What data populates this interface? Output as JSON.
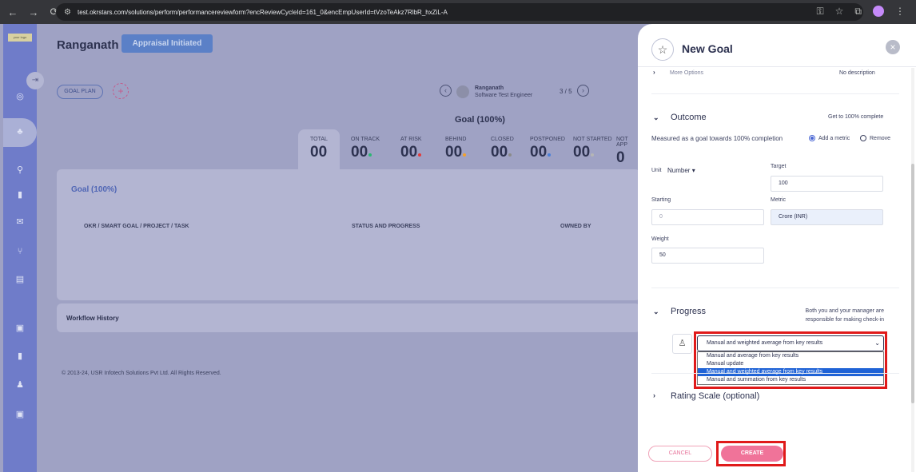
{
  "browser": {
    "url": "test.okrstars.com/solutions/perform/performancereviewform?encReviewCycleId=161_0&encEmpUserId=tVzoTeAkz7RlbR_hxZiL-A"
  },
  "sidebar": {
    "logo_text": "your logo"
  },
  "header": {
    "employee_name": "Ranganath",
    "status": "Appraisal Initiated"
  },
  "goal_plan": {
    "button_label": "GOAL PLAN",
    "nav": {
      "name": "Ranganath",
      "role": "Software Test Engineer",
      "counter": "3 / 5"
    },
    "goal_percent": "Goal (100%)"
  },
  "stats": [
    {
      "label": "TOTAL",
      "value": "00",
      "dot": ""
    },
    {
      "label": "ON TRACK",
      "value": "00",
      "dot": "#2bb673"
    },
    {
      "label": "AT RISK",
      "value": "00",
      "dot": "#e23a3a"
    },
    {
      "label": "BEHIND",
      "value": "00",
      "dot": "#f2a12c"
    },
    {
      "label": "CLOSED",
      "value": "00",
      "dot": "#8a8a8a"
    },
    {
      "label": "POSTPONED",
      "value": "00",
      "dot": "#4a80d8"
    },
    {
      "label": "NOT STARTED",
      "value": "00",
      "dot": "#b5b5b5"
    },
    {
      "label": "NOT APP",
      "value": "0",
      "dot": ""
    }
  ],
  "goal_card": {
    "tab_label": "Goal (100%)",
    "columns": [
      "OKR / SMART GOAL / PROJECT / TASK",
      "STATUS AND PROGRESS",
      "OWNED BY"
    ]
  },
  "workflow": {
    "label": "Workflow History"
  },
  "footer": {
    "text": "© 2013-24, USR Infotech Solutions Pvt Ltd. All Rights Reserved."
  },
  "drawer": {
    "title": "New Goal",
    "more_options": "More Options",
    "no_description": "No description",
    "outcome": {
      "title": "Outcome",
      "hint": "Get to 100% complete",
      "measured_text": "Measured as a goal towards 100% completion",
      "radio_add": "Add a metric",
      "radio_remove": "Remove",
      "unit_label": "Unit",
      "unit_value": "Number",
      "target_label": "Target",
      "target_value": "100",
      "starting_label": "Starting",
      "starting_value": "0",
      "metric_label": "Metric",
      "metric_value": "Crore (INR)",
      "weight_label": "Weight",
      "weight_value": "50"
    },
    "progress": {
      "title": "Progress",
      "hint_line1": "Both you and your manager are",
      "hint_line2": "responsible for making check-in",
      "selected": "Manual and weighted average from key results",
      "options": [
        "Manual and average from key results",
        "Manual update",
        "Manual and weighted average from key results",
        "Manual and summation from key results"
      ]
    },
    "rating_scale": {
      "title": "Rating Scale (optional)"
    },
    "cancel_label": "CANCEL",
    "create_label": "CREATE"
  }
}
